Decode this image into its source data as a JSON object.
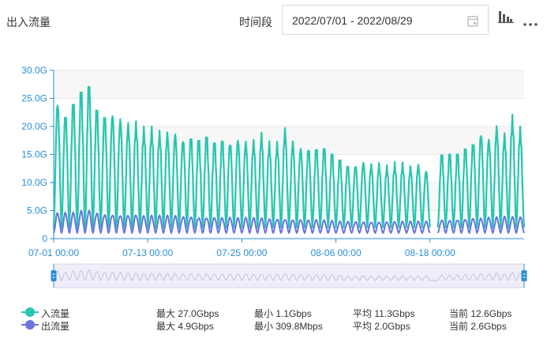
{
  "header": {
    "title": "出入流量",
    "range_label": "时间段",
    "range_value": "2022/07/01 - 2022/08/29"
  },
  "icons": {
    "calendar": "calendar-icon",
    "chart_type": "bar-chart-icon",
    "more": "more-icon"
  },
  "chart_data": {
    "type": "line",
    "x_ticks": [
      "07-01 00:00",
      "07-13 00:00",
      "07-25 00:00",
      "08-06 00:00",
      "08-18 00:00"
    ],
    "y_ticks": [
      "30.0G",
      "25.0G",
      "20.0G",
      "15.0G",
      "10.0G",
      "5.0G",
      "0"
    ],
    "ylim": [
      0,
      30
    ],
    "x_range_days": [
      0,
      60
    ],
    "series": [
      {
        "name": "入流量",
        "color": "#26c6b0",
        "daily_peaks": [
          24,
          22,
          24,
          26,
          27,
          23,
          22,
          22,
          21,
          20,
          20,
          19,
          19,
          18.5,
          18.5,
          18.5,
          17.5,
          18,
          17.5,
          18,
          17,
          17.5,
          17,
          17.5,
          17,
          17,
          18,
          16.5,
          16.5,
          19,
          17,
          16,
          16,
          16,
          16,
          15,
          14,
          13,
          13,
          13.5,
          13,
          13,
          12.5,
          13,
          13,
          12.5,
          13,
          12,
          null,
          15,
          15,
          15,
          16,
          17,
          18.5,
          17.5,
          19.5,
          18,
          21,
          19
        ],
        "daily_lows": [
          2,
          2,
          2,
          2,
          2,
          2,
          2,
          2,
          2,
          2,
          2,
          2,
          2,
          2,
          2,
          2,
          2,
          2,
          2,
          2,
          2,
          2,
          2,
          2,
          2,
          2,
          2,
          2,
          2,
          2,
          2,
          2,
          2,
          2,
          2,
          2,
          2,
          2,
          2,
          2,
          2,
          2,
          2,
          2,
          2,
          2,
          2,
          2,
          null,
          2,
          2,
          2,
          2,
          2,
          2,
          2,
          2,
          2,
          2,
          2
        ]
      },
      {
        "name": "出流量",
        "color": "#6a74e0",
        "daily_peaks": [
          4.5,
          4.5,
          4.5,
          4.8,
          4.9,
          4.5,
          4.3,
          4.3,
          4.2,
          4.2,
          4.2,
          4,
          4,
          4,
          4,
          4,
          3.9,
          3.9,
          3.8,
          3.8,
          3.8,
          3.7,
          3.7,
          3.6,
          3.6,
          3.6,
          3.6,
          3.5,
          3.5,
          3.5,
          3.4,
          3.4,
          3.3,
          3.3,
          3.2,
          3.1,
          3,
          3,
          3,
          3,
          3,
          3,
          3,
          3,
          3,
          3,
          3,
          3,
          null,
          3.3,
          3.3,
          3.4,
          3.5,
          3.6,
          3.6,
          3.7,
          3.7,
          3.8,
          3.8,
          3.8
        ],
        "daily_lows": [
          1,
          1,
          1,
          1,
          1,
          1,
          1,
          1,
          1,
          1,
          1,
          1,
          1,
          1,
          1,
          1,
          1,
          1,
          1,
          1,
          1,
          1,
          1,
          1,
          1,
          1,
          1,
          1,
          1,
          1,
          1,
          1,
          1,
          1,
          1,
          1,
          1,
          1,
          1,
          1,
          1,
          1,
          1,
          1,
          1,
          1,
          1,
          1,
          null,
          1,
          1,
          1,
          1,
          1,
          1,
          1,
          1,
          1,
          1,
          1
        ]
      }
    ],
    "grid": true
  },
  "legend": [
    {
      "name": "入流量",
      "color": "#26c6b0",
      "max": "最大 27.0Gbps",
      "min": "最小 1.1Gbps",
      "avg": "平均 11.3Gbps",
      "cur": "当前 12.6Gbps"
    },
    {
      "name": "出流量",
      "color": "#6a74e0",
      "max": "最大 4.9Gbps",
      "min": "最小 309.8Mbps",
      "avg": "平均 2.0Gbps",
      "cur": "当前 2.6Gbps"
    }
  ]
}
